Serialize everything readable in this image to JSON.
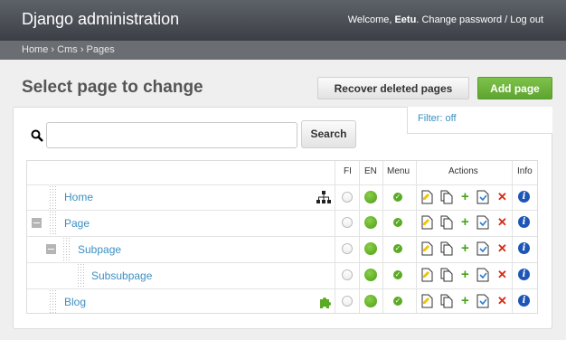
{
  "header": {
    "site_title": "Django administration",
    "welcome": "Welcome,",
    "username": "Eetu",
    "change_password": "Change password",
    "separator": "/",
    "logout": "Log out"
  },
  "breadcrumbs": {
    "items": [
      "Home",
      "Cms",
      "Pages"
    ],
    "sep": "›"
  },
  "page": {
    "heading": "Select page to change",
    "recover_label": "Recover deleted pages",
    "add_label": "Add page"
  },
  "filter": {
    "label": "Filter: off"
  },
  "search": {
    "button_label": "Search",
    "value": ""
  },
  "columns": {
    "fi": "FI",
    "en": "EN",
    "menu": "Menu",
    "actions": "Actions",
    "info": "Info"
  },
  "rows": [
    {
      "title": "Home",
      "fi": "unpublished",
      "en": "published",
      "menu": true,
      "icon": "sitemap-icon"
    },
    {
      "title": "Page",
      "fi": "unpublished",
      "en": "published",
      "menu": true,
      "icon": ""
    },
    {
      "title": "Subpage",
      "fi": "unpublished",
      "en": "published",
      "menu": true,
      "icon": ""
    },
    {
      "title": "Subsubpage",
      "fi": "unpublished",
      "en": "published",
      "menu": true,
      "icon": ""
    },
    {
      "title": "Blog",
      "fi": "unpublished",
      "en": "published",
      "menu": true,
      "icon": "plugin-icon"
    }
  ],
  "colors": {
    "accent": "#3d8fc1",
    "add_button": "#6cb33c",
    "published": "#5aaa25",
    "delete": "#d62a16",
    "info": "#1d56b6"
  }
}
